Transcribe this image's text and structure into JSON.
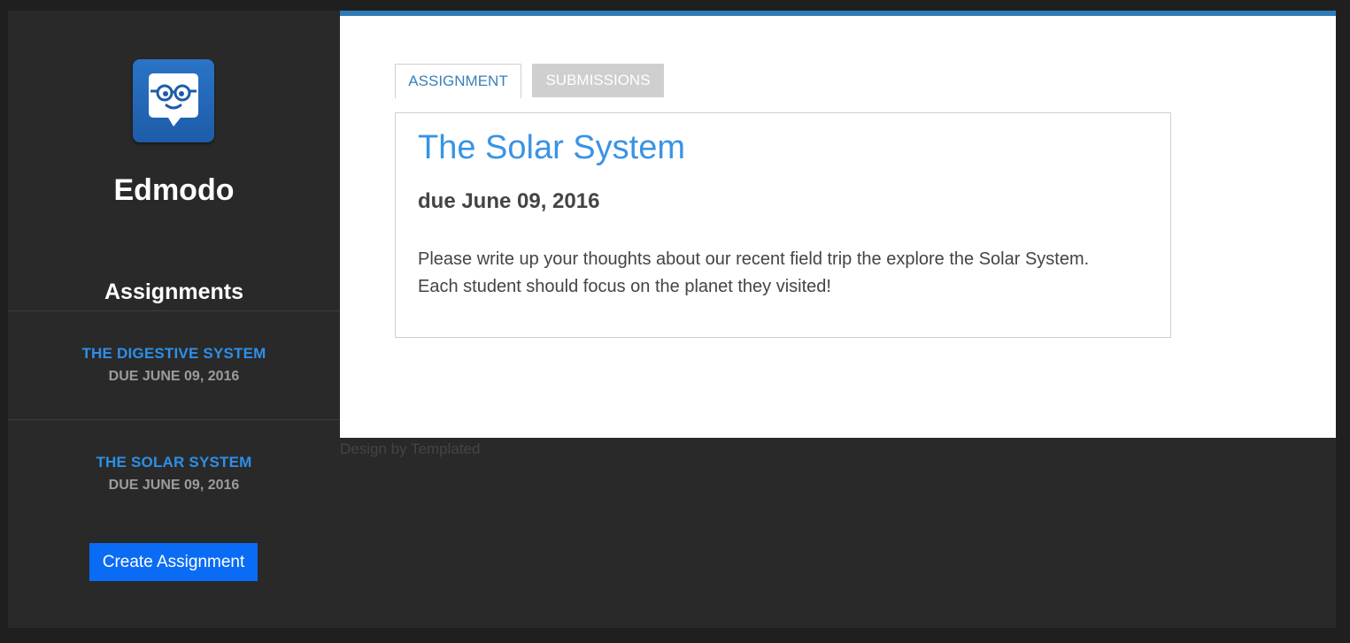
{
  "app": {
    "brand_name": "Edmodo",
    "logo_icon": "edmodo-mascot-icon",
    "accent_color": "#2e7cb8"
  },
  "sidebar": {
    "heading": "Assignments",
    "items": [
      {
        "title": "THE DIGESTIVE SYSTEM",
        "due": "DUE JUNE 09, 2016"
      },
      {
        "title": "THE SOLAR SYSTEM",
        "due": "DUE JUNE 09, 2016"
      }
    ],
    "create_button_label": "Create Assignment"
  },
  "tabs": [
    {
      "label": "ASSIGNMENT",
      "active": true
    },
    {
      "label": "SUBMISSIONS",
      "active": false
    }
  ],
  "assignment": {
    "title": "The Solar System",
    "due": "due June 09, 2016",
    "description": "Please write up your thoughts about our recent field trip the explore the Solar System. Each student should focus on the planet they visited!"
  },
  "footer": {
    "credit": "Design by Templated"
  }
}
